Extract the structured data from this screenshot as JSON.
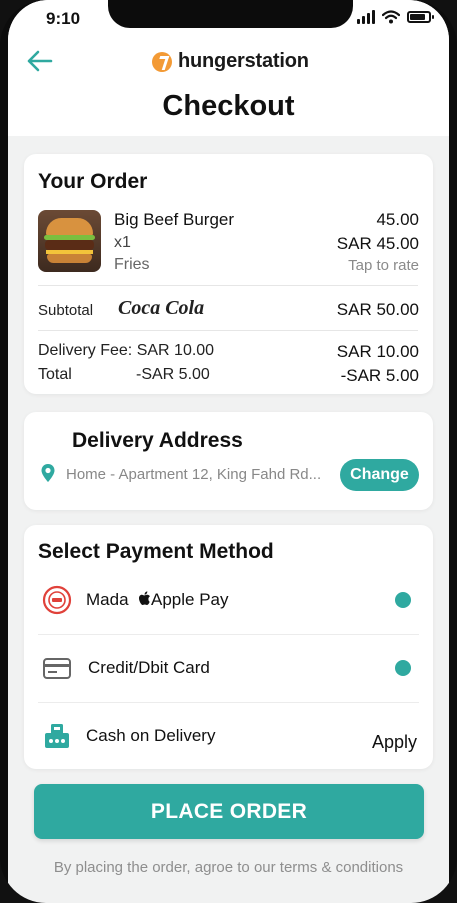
{
  "status_bar": {
    "time": "9:10"
  },
  "header": {
    "brand": "hungerstation",
    "title": "Checkout"
  },
  "order": {
    "title": "Your Order",
    "item": {
      "name": "Big Beef Burger",
      "quantity": "x1",
      "side": "Fries",
      "price": "45.00",
      "total": "SAR 45.00",
      "rate_link": "Tap to rate"
    },
    "subtotal_label": "Subtotal",
    "brand_mark": "Coca Cola",
    "subtotal_value": "SAR 50.00",
    "delivery_fee_label": "Delivery Fee: SAR 10.00",
    "delivery_fee_value": "SAR 10.00",
    "total_label": "Total",
    "total_mid": "-SAR 5.00",
    "total_value": "-SAR 5.00"
  },
  "address": {
    "title": "Delivery Address",
    "text": "Home - Apartment 12, King Fahd Rd...",
    "change_label": "Change"
  },
  "payment": {
    "title": "Select Payment Method",
    "methods": [
      {
        "label": "Mada",
        "extra": "Apple Pay",
        "icon": "mada-icon",
        "selected": true
      },
      {
        "label": "Credit/Dbit Card",
        "icon": "credit-card-icon",
        "selected": true
      },
      {
        "label": "Cash on Delivery",
        "icon": "cash-icon",
        "action": "Apply"
      }
    ]
  },
  "place_order_label": "PLACE ORDER",
  "terms": "By placing the order, agroe to our terms & conditions",
  "colors": {
    "accent": "#2fa9a0",
    "brand": "#f39a35",
    "background": "#f1f2f2"
  }
}
